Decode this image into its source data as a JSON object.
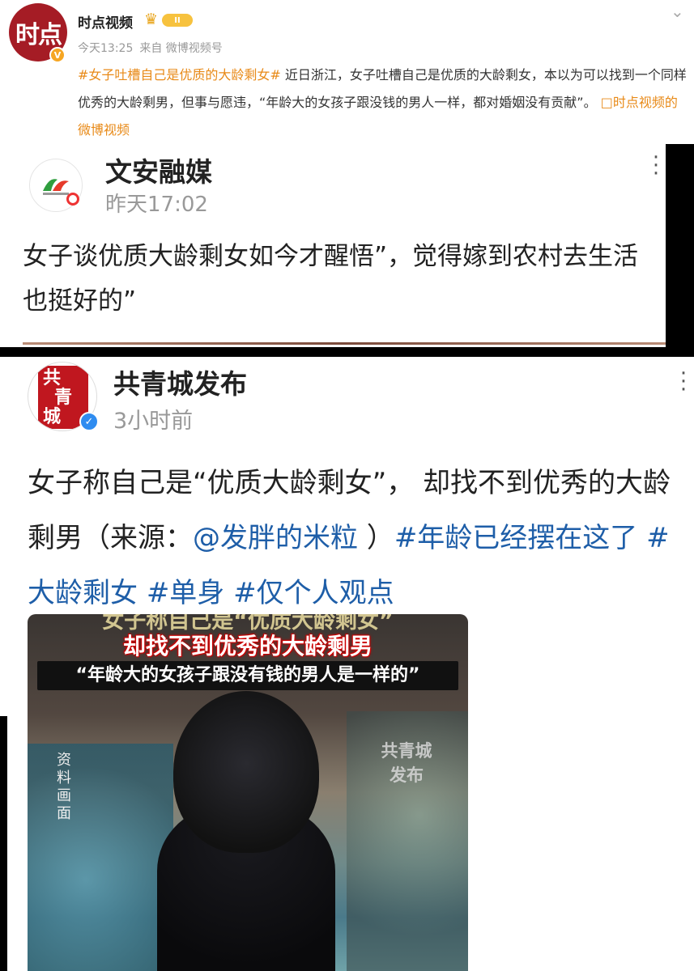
{
  "post1": {
    "author": "时点视频",
    "level": "II",
    "logo_text": "时点",
    "time": "今天13:25",
    "source": "来自 微博视频号",
    "hashtag": "#女子吐槽自己是优质的大龄剩女#",
    "text": " 近日浙江，女子吐槽自己是优质的大龄剩女，本以为可以找到一个同样优秀的大龄剩男，但事与愿违，“年龄大的女孩子跟没钱的男人一样，都对婚姻没有贡献”。",
    "link": "时点视频的微博视频"
  },
  "post2": {
    "author": "文安融媒",
    "time": "昨天17:02",
    "text": "女子谈优质大龄剩女如今才醒悟”，觉得嫁到农村去生活也挺好的”"
  },
  "post3": {
    "author": "共青城发布",
    "avatar_text": [
      "共",
      "青",
      "城"
    ],
    "time": "3小时前",
    "text_part1": "女子称自己是“优质大龄剩女”， 却找不到优秀的大龄剩男（来源：",
    "mention": "@发胖的米粒",
    "text_part2": " ）",
    "tags": [
      "#年龄已经摆在这了",
      "#大龄剩女",
      "#单身",
      "#仅个人观点"
    ],
    "video": {
      "caption_top": "女子称自己是“优质大龄剩女”",
      "caption_main": "却找不到优秀的大龄剩男",
      "caption_quote": "“年龄大的女孩子跟没有钱的男人是一样的”",
      "watermark": "共青城发布",
      "side_label": "资料画面"
    }
  },
  "colors": {
    "hashtag_orange": "#e88a18",
    "tag_blue": "#1e5ea8",
    "seal_red": "#c0171f",
    "verified_blue": "#2f8cf0"
  }
}
